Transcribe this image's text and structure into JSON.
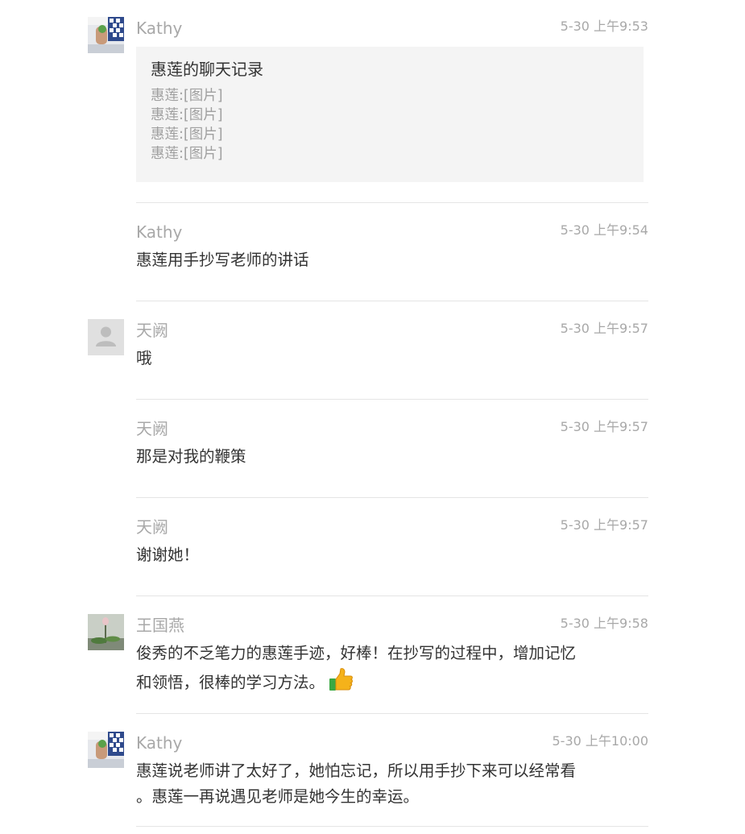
{
  "messages": [
    {
      "sender": "Kathy",
      "time": "5-30 上午9:53",
      "type": "chat-record",
      "record": {
        "title": "惠莲的聊天记录",
        "lines": [
          "惠莲:[图片]",
          "惠莲:[图片]",
          "惠莲:[图片]",
          "惠莲:[图片]"
        ]
      }
    },
    {
      "sender": "Kathy",
      "time": "5-30 上午9:54",
      "text": "惠莲用手抄写老师的讲话"
    },
    {
      "sender": "天阙",
      "time": "5-30 上午9:57",
      "text": "哦"
    },
    {
      "sender": "天阙",
      "time": "5-30 上午9:57",
      "text": "那是对我的鞭策"
    },
    {
      "sender": "天阙",
      "time": "5-30 上午9:57",
      "text": "谢谢她！"
    },
    {
      "sender": "王国燕",
      "time": "5-30 上午9:58",
      "text_line1": "俊秀的不乏笔力的惠莲手迹，好棒！在抄写的过程中，增加记忆",
      "text_line2": "和领悟，很棒的学习方法。",
      "emoji": "thumbs-up-icon"
    },
    {
      "sender": "Kathy",
      "time": "5-30 上午10:00",
      "text_line1": "惠莲说老师讲了太好了，她怕忘记，所以用手抄下来可以经常看",
      "text_line2": "。惠莲一再说遇见老师是她今生的幸运。"
    }
  ],
  "colors": {
    "name": "#a8a8a8",
    "time": "#a8a8a8",
    "text": "#333333",
    "record_bg": "#f4f4f4",
    "separator": "#e5e5e5",
    "thumb": "#f5b21a",
    "thumb_cuff": "#3aa843"
  }
}
